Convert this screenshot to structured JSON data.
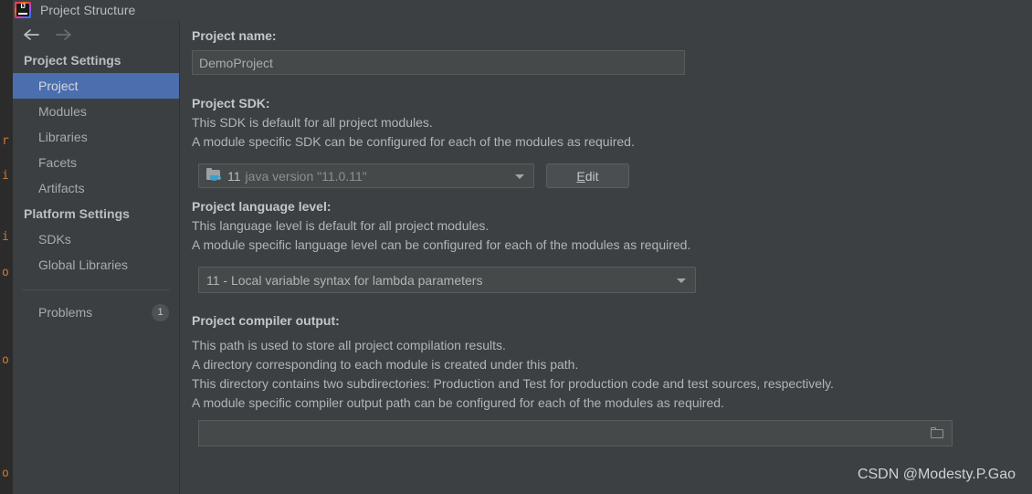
{
  "window": {
    "title": "Project Structure",
    "app_icon": "intellij-idea-icon"
  },
  "nav": {
    "back_icon": "arrow-left-icon",
    "forward_icon": "arrow-right-icon"
  },
  "sidebar": {
    "groups": [
      {
        "label": "Project Settings",
        "items": [
          {
            "label": "Project",
            "selected": true
          },
          {
            "label": "Modules",
            "selected": false
          },
          {
            "label": "Libraries",
            "selected": false
          },
          {
            "label": "Facets",
            "selected": false
          },
          {
            "label": "Artifacts",
            "selected": false
          }
        ]
      },
      {
        "label": "Platform Settings",
        "items": [
          {
            "label": "SDKs",
            "selected": false
          },
          {
            "label": "Global Libraries",
            "selected": false
          }
        ]
      }
    ],
    "problems": {
      "label": "Problems",
      "badge": "1"
    }
  },
  "main": {
    "project_name": {
      "label": "Project name:",
      "value": "DemoProject",
      "placeholder": ""
    },
    "project_sdk": {
      "label": "Project SDK:",
      "descriptions": [
        "This SDK is default for all project modules.",
        "A module specific SDK can be configured for each of the modules as required."
      ],
      "icon": "java-sdk-folder-icon",
      "value_main": "11",
      "value_detail": "java version \"11.0.11\"",
      "edit_button": {
        "mnemonic": "E",
        "rest": "dit"
      }
    },
    "language_level": {
      "label": "Project language level:",
      "descriptions": [
        "This language level is default for all project modules.",
        "A module specific language level can be configured for each of the modules as required."
      ],
      "value": "11 - Local variable syntax for lambda parameters"
    },
    "compiler_output": {
      "label": "Project compiler output:",
      "descriptions": [
        "This path is used to store all project compilation results.",
        "A directory corresponding to each module is created under this path.",
        "This directory contains two subdirectories: Production and Test for production code and test sources, respectively.",
        "A module specific compiler output path can be configured for each of the modules as required."
      ],
      "value": "",
      "placeholder": "",
      "browse_icon": "folder-open-icon"
    }
  },
  "watermark": "CSDN @Modesty.P.Gao",
  "editor_sliver": {
    "fragments": [
      "r",
      "i",
      "i",
      "o",
      "o",
      "o"
    ]
  },
  "colors": {
    "accent_selection": "#4b6eaf",
    "sidebar_bg": "#3c3f41",
    "panel_bg": "#3c4043",
    "editor_bg": "#2b2b2b",
    "editor_keyword": "#cc7832"
  }
}
